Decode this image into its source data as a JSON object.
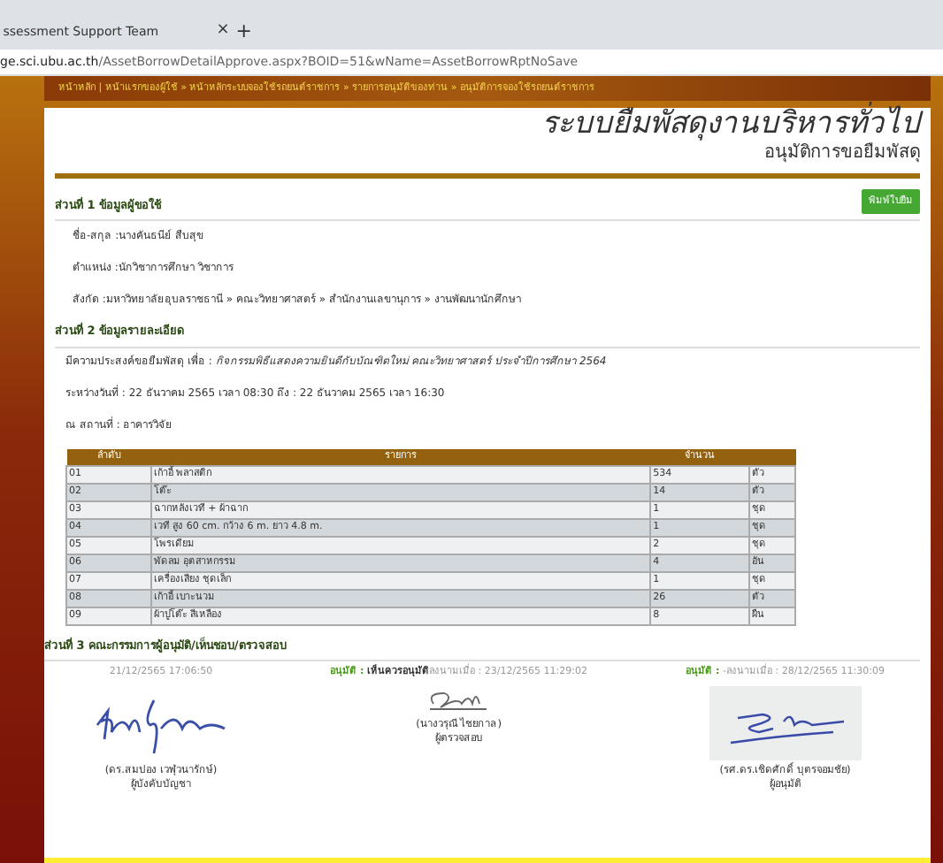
{
  "browser": {
    "tab_title": "ssessment Support Team",
    "tab_close": "×",
    "new_tab": "+",
    "url_host": "ge.sci.ubu.ac.th",
    "url_path": "/AssetBorrowDetailApprove.aspx?BOID=51&wName=AssetBorrowRptNoSave"
  },
  "breadcrumb": "หน้าหลัก | หน้าแรกของผู้ใช้ » หน้าหลักระบบจองใช้รถยนต์ราชการ » รายการอนุมัติของท่าน » อนุมัติการจองใช้รถยนต์ราชการ",
  "title": "ระบบยืมพัสดุงานบริหารทั่วไป",
  "subtitle": "อนุมัติการขอยืมพัสดุ",
  "section_1": {
    "heading": "ส่วนที่ 1 ข้อมูลผู้ขอใช้",
    "print_button": "พิมพ์ใบยืม",
    "lines": [
      "ชื่อ-สกุล :นางคันธนีย์ สืบสุข",
      "ตำแหน่ง :นักวิชาการศึกษา วิชาการ",
      "สังกัด :มหาวิทยาลัยอุบลราชธานี » คณะวิทยาศาสตร์ » สำนักงานเลขานุการ » งานพัฒนานักศึกษา"
    ]
  },
  "section_2": {
    "heading": "ส่วนที่ 2 ข้อมูลรายละเอียด",
    "lines": [
      "มีความประสงค์ขอยืมพัสดุ เพื่อ : *กิจกรรมพิธีแสดงความยินดีกับบัณฑิตใหม่ คณะวิทยาศาสตร์ ประจำปีการศึกษา 2564*",
      "ระหว่างวันที่ : 22 ธันวาคม 2565 เวลา 08:30  ถึง : 22 ธันวาคม 2565 เวลา 16:30",
      "ณ สถานที่ : อาคารวิจัย"
    ],
    "table": {
      "columns": [
        "ลำดับ",
        "รายการ",
        "จำนวน"
      ],
      "rows": [
        [
          "01",
          "เก้าอี้ พลาสติก",
          "534",
          "ตัว"
        ],
        [
          "02",
          "โต๊ะ",
          "14",
          "ตัว"
        ],
        [
          "03",
          "ฉากหลังเวที + ผ้าฉาก",
          "1",
          "ชุด"
        ],
        [
          "04",
          "เวที สูง 60 cm. กว้าง 6 m. ยาว 4.8 m.",
          "1",
          "ชุด"
        ],
        [
          "05",
          "โพรเดียม",
          "2",
          "ชุด"
        ],
        [
          "06",
          "พัดลม อุตสาหกรรม",
          "4",
          "อัน"
        ],
        [
          "07",
          "เครื่องเสียง ชุดเล็ก",
          "1",
          "ชุด"
        ],
        [
          "08",
          "เก้าอี้ เบาะนวม",
          "26",
          "ตัว"
        ],
        [
          "09",
          "ผ้าปูโต๊ะ สีเหลือง",
          "8",
          "ผืน"
        ]
      ]
    }
  },
  "section_3": {
    "heading": "ส่วนที่ 3 คณะกรรมการผู้อนุมัติ/เห็นชอบ/ตรวจสอบ",
    "signers": [
      {
        "signed": "21/12/2565 17:06:50",
        "name": "(ดร.สมปอง เวฬุวนารักษ์)",
        "role": "ผู้บังคับบัญชา",
        "kind": "plain"
      },
      {
        "status_label": "อนุมัติ :",
        "decision": "เห็นควรอนุมัติ",
        "signed": "ลงนามเมื่อ : 23/12/2565 11:29:02",
        "name": "(นางวรุณี ไชยกาล)",
        "role": "ผู้ตรวจสอบ",
        "kind": "small"
      },
      {
        "status_label": "อนุมัติ :",
        "signed": "-ลงนามเมื่อ : 28/12/2565 11:30:09",
        "name": "(รศ.ดร.เชิดศักดิ์ บุตรจอมชัย)",
        "role": "ผู้อนุมัติ",
        "kind": "scanned"
      }
    ]
  }
}
